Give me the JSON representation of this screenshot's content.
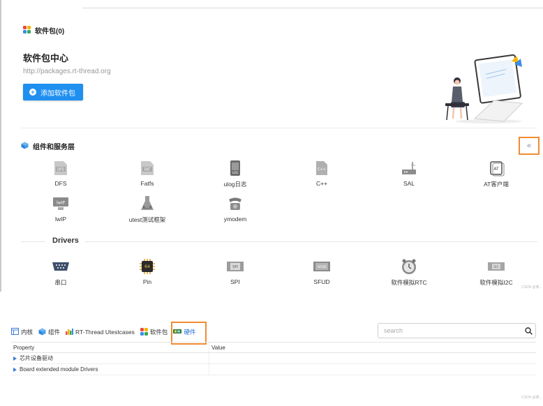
{
  "packages": {
    "header": "软件包(0)",
    "center_title": "软件包中心",
    "url": "http://packages.rt-thread.org",
    "add_button": "添加软件包"
  },
  "services": {
    "header": "组件和服务层",
    "collapse_glyph": "«",
    "items": [
      {
        "label": "DFS",
        "icon": "dfs-icon",
        "badge": "DFS"
      },
      {
        "label": "Fatfs",
        "icon": "fatfs-icon",
        "badge": "FAT"
      },
      {
        "label": "ulog日志",
        "icon": "ulog-icon",
        "badge": "LOG"
      },
      {
        "label": "C++",
        "icon": "cpp-icon",
        "badge": "C++"
      },
      {
        "label": "SAL",
        "icon": "sal-icon",
        "badge": "SAL"
      },
      {
        "label": "AT客户端",
        "icon": "at-icon",
        "badge": "AT"
      },
      {
        "label": "lwIP",
        "icon": "lwip-icon",
        "badge": "lwIP"
      },
      {
        "label": "utest测试框架",
        "icon": "utest-icon",
        "badge": "TEST"
      },
      {
        "label": "ymodem",
        "icon": "ymodem-icon",
        "badge": ""
      }
    ]
  },
  "drivers": {
    "title": "Drivers",
    "items": [
      {
        "label": "串口",
        "icon": "serial-port-icon",
        "badge": ""
      },
      {
        "label": "Pin",
        "icon": "pin-chip-icon",
        "badge": "64"
      },
      {
        "label": "SPI",
        "icon": "spi-icon",
        "badge": "SPI"
      },
      {
        "label": "SFUD",
        "icon": "sfud-icon",
        "badge": "SFUD"
      },
      {
        "label": "软件模拟RTC",
        "icon": "rtc-clock-icon",
        "badge": ""
      },
      {
        "label": "软件模拟I2C",
        "icon": "i2c-icon",
        "badge": "I2C"
      }
    ]
  },
  "watermark": "CSDN @某...",
  "tabs": [
    {
      "label": "内核",
      "icon": "kernel-icon"
    },
    {
      "label": "组件",
      "icon": "component-icon"
    },
    {
      "label": "RT-Thread Utestcases",
      "icon": "utestcases-icon"
    },
    {
      "label": "软件包",
      "icon": "package-icon"
    },
    {
      "label": "硬件",
      "icon": "hardware-icon"
    }
  ],
  "search": {
    "placeholder": "search",
    "value": ""
  },
  "table": {
    "headers": [
      "Property",
      "Value"
    ],
    "rows": [
      {
        "property": "芯片设备驱动",
        "value": ""
      },
      {
        "property": "Board extended module Drivers",
        "value": ""
      }
    ]
  },
  "colors": {
    "accent": "#1f8ff0",
    "highlight": "#f28b30"
  }
}
